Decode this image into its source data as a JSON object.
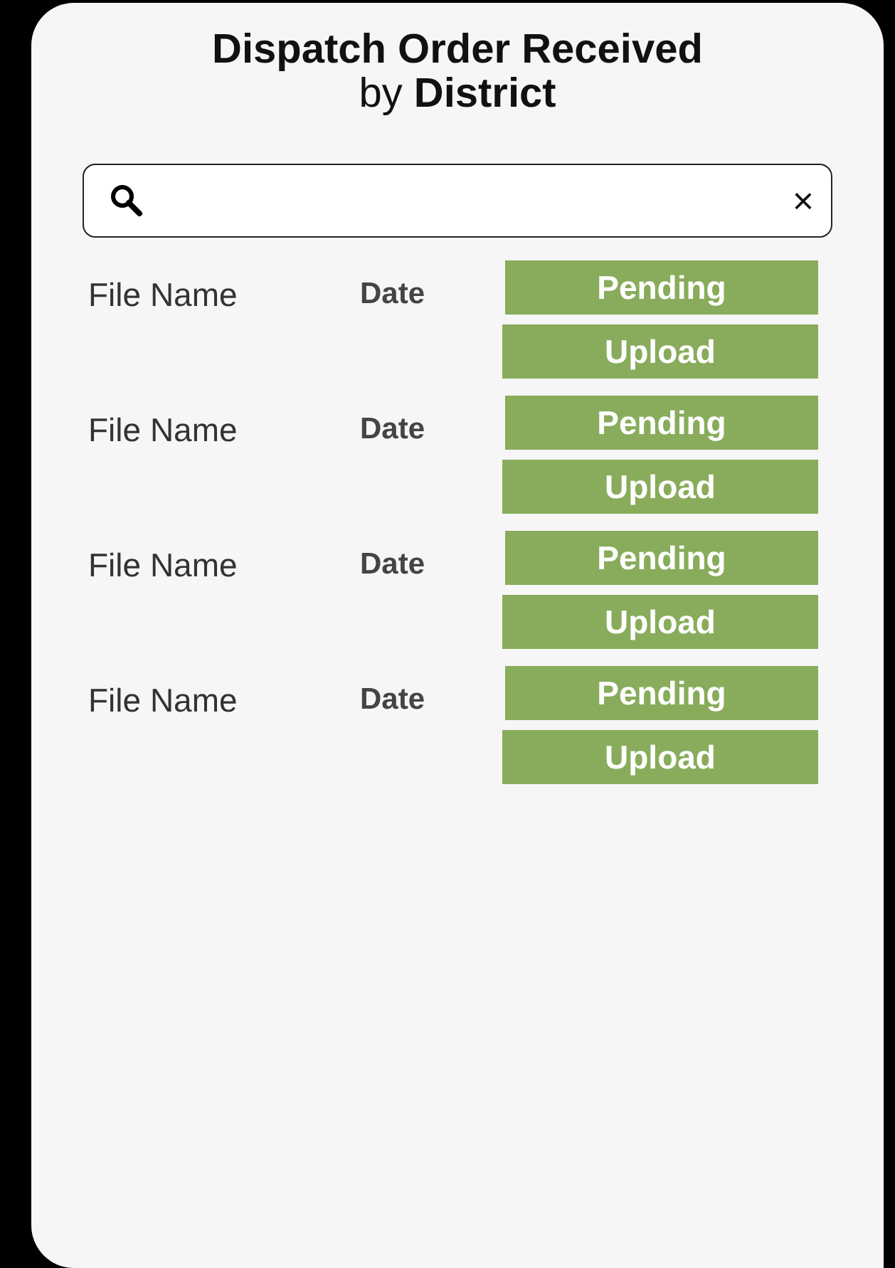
{
  "title": "Dispatch Order Received",
  "subtitle": "by **District**",
  "search": {
    "clear": "×"
  },
  "files": [
    {
      "name": "File Name",
      "date": "Date",
      "status": "Pending",
      "action": "Upload"
    },
    {
      "name": "File Name",
      "date": "Date",
      "status": "Pending",
      "action": "Upload"
    },
    {
      "name": "File Name",
      "date": "Date",
      "status": "Pending",
      "action": "Upload"
    },
    {
      "name": "File Name",
      "date": "Date",
      "status": "Pending",
      "action": "Upload"
    }
  ]
}
